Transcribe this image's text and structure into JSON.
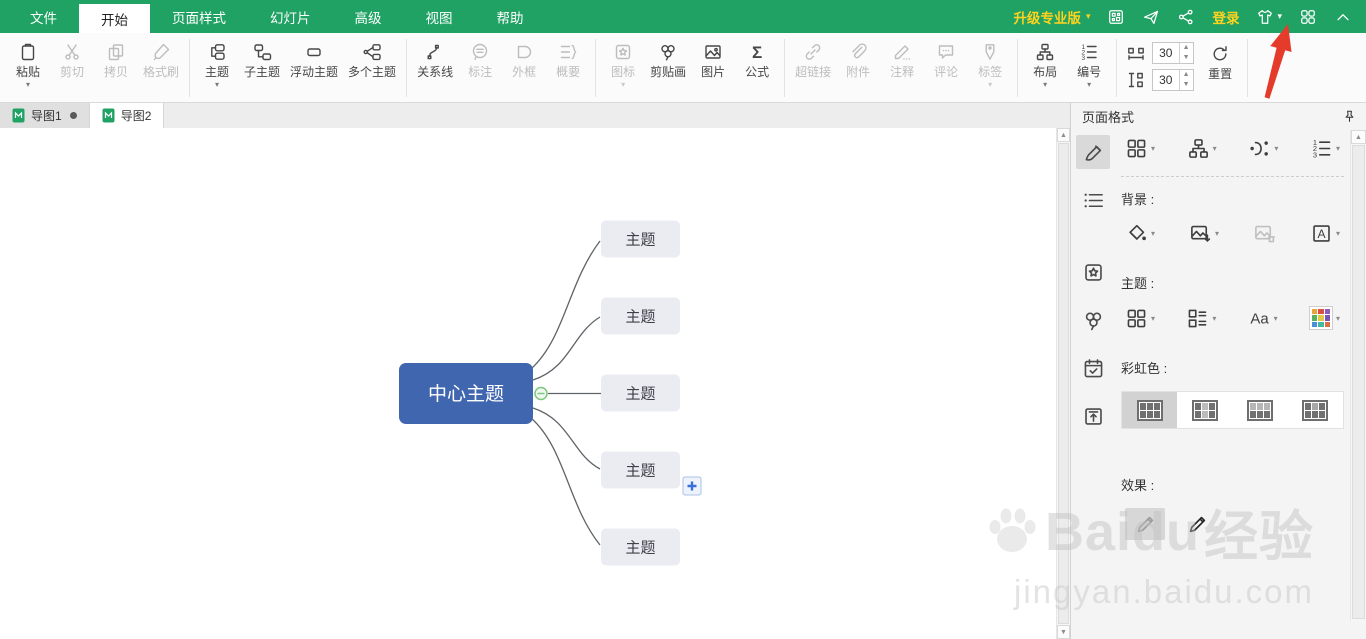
{
  "menu": {
    "tabs": [
      "文件",
      "开始",
      "页面样式",
      "幻灯片",
      "高级",
      "视图",
      "帮助"
    ],
    "active_tab": "开始",
    "upgrade": "升级专业版",
    "login": "登录"
  },
  "toolbar": {
    "paste": "粘贴",
    "cut": "剪切",
    "copy": "拷贝",
    "format_painter": "格式刷",
    "topic": "主题",
    "subtopic": "子主题",
    "floating_topic": "浮动主题",
    "multiple_topics": "多个主题",
    "relationship": "关系线",
    "callout": "标注",
    "boundary": "外框",
    "summary": "概要",
    "icon": "图标",
    "clipart": "剪贴画",
    "picture": "图片",
    "formula": "公式",
    "hyperlink": "超链接",
    "attachment": "附件",
    "note": "注释",
    "comment": "评论",
    "tag": "标签",
    "layout": "布局",
    "numbering": "编号",
    "h_spacing": "30",
    "v_spacing": "30",
    "reset": "重置"
  },
  "doc_tabs": [
    {
      "label": "导图1",
      "modified": true,
      "active": false
    },
    {
      "label": "导图2",
      "modified": false,
      "active": true
    }
  ],
  "panel": {
    "title": "页面格式",
    "background_label": "背景 :",
    "theme_label": "主题 :",
    "rainbow_label": "彩虹色 :",
    "effect_label": "效果 :"
  },
  "mindmap": {
    "center_topic": "中心主题",
    "topics": [
      "主题",
      "主题",
      "主题",
      "主题",
      "主题"
    ]
  },
  "watermark": {
    "brand": "Baidu",
    "suffix": "经验",
    "url": "jingyan.baidu.com"
  },
  "colors": {
    "menubar_green": "#1fa263",
    "accent_gold": "#ffd21e",
    "center_topic_blue": "#4166b0",
    "topic_fill": "#eaecf2",
    "arrow_red": "#e43b2b",
    "handle_green": "#7dc87d"
  }
}
